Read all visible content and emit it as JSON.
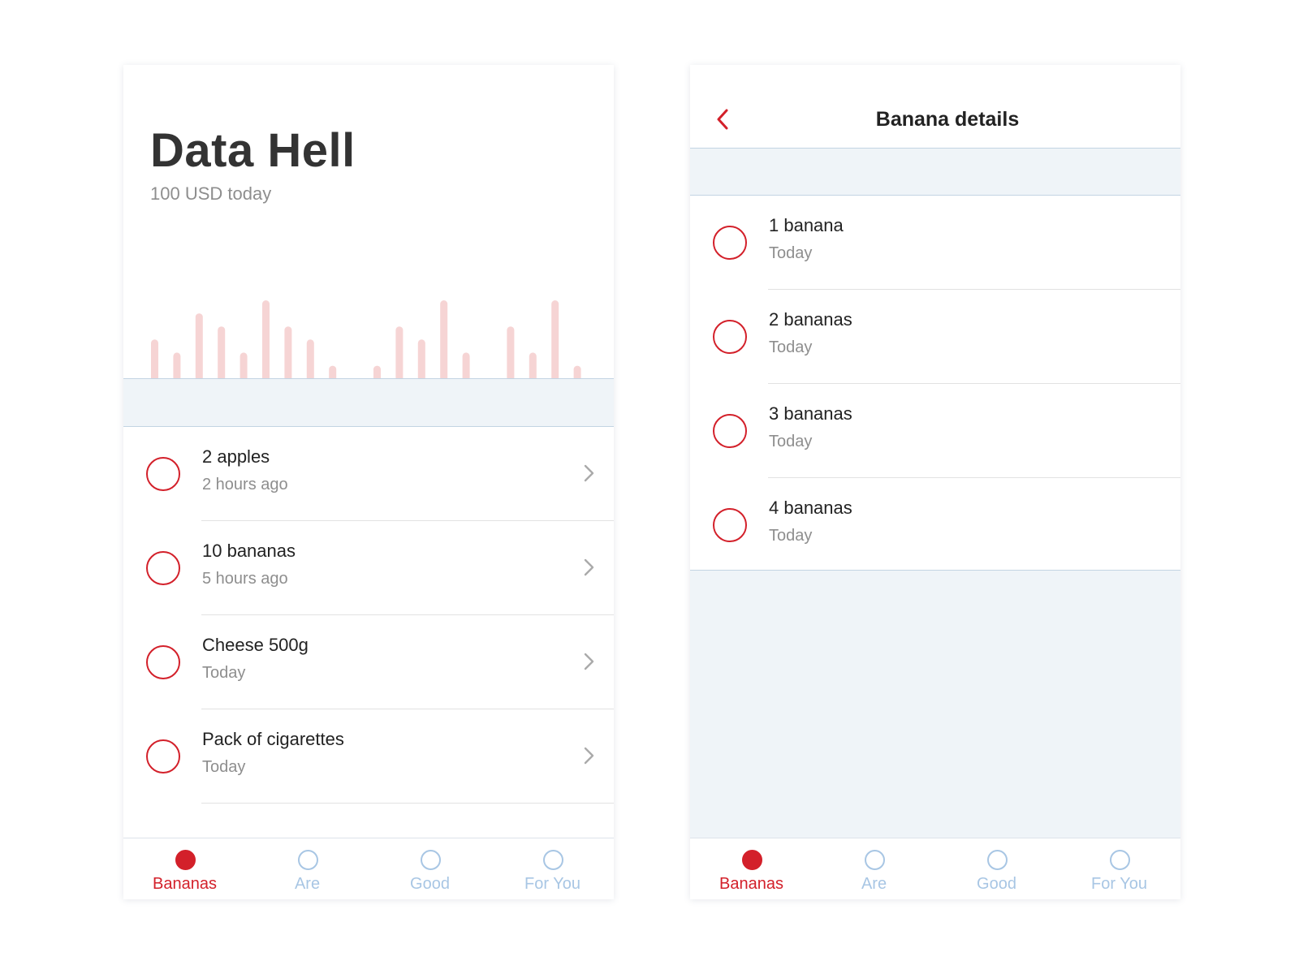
{
  "colors": {
    "accent": "#d3202a",
    "bar": "#f6d4d4",
    "inactive_tab": "#a8c6e4",
    "band": "#eff4f8"
  },
  "home": {
    "title": "Data Hell",
    "subtitle": "100 USD today",
    "chart_data": {
      "type": "bar",
      "values": [
        6,
        5,
        8,
        7,
        5,
        9,
        7,
        6,
        4,
        1,
        4,
        7,
        6,
        9,
        5,
        3,
        7,
        5,
        9,
        4
      ],
      "ylim": [
        0,
        9
      ]
    },
    "items": [
      {
        "title": "2 apples",
        "subtitle": "2 hours ago"
      },
      {
        "title": "10 bananas",
        "subtitle": "5 hours ago"
      },
      {
        "title": "Cheese 500g",
        "subtitle": "Today"
      },
      {
        "title": "Pack of cigarettes",
        "subtitle": "Today"
      }
    ]
  },
  "details": {
    "title": "Banana details",
    "items": [
      {
        "title": "1 banana",
        "subtitle": "Today"
      },
      {
        "title": "2 bananas",
        "subtitle": "Today"
      },
      {
        "title": "3 bananas",
        "subtitle": "Today"
      },
      {
        "title": "4 bananas",
        "subtitle": "Today"
      }
    ]
  },
  "tabs": [
    {
      "label": "Bananas",
      "active": true
    },
    {
      "label": "Are",
      "active": false
    },
    {
      "label": "Good",
      "active": false
    },
    {
      "label": "For You",
      "active": false
    }
  ]
}
